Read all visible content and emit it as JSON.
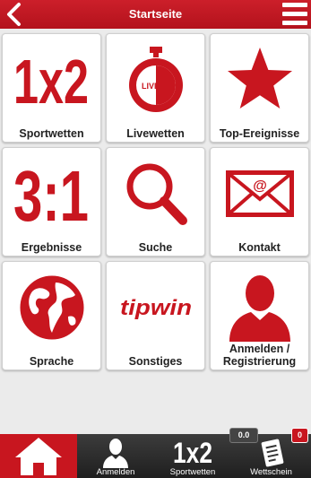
{
  "header": {
    "title": "Startseite"
  },
  "tiles": [
    {
      "label": "Sportwetten",
      "icon": "1x2-icon"
    },
    {
      "label": "Livewetten",
      "icon": "live-stopwatch-icon",
      "icon_text": "LIVE"
    },
    {
      "label": "Top-Ereignisse",
      "icon": "star-icon"
    },
    {
      "label": "Ergebnisse",
      "icon": "score-3-1-icon"
    },
    {
      "label": "Suche",
      "icon": "magnifier-icon"
    },
    {
      "label": "Kontakt",
      "icon": "envelope-at-icon"
    },
    {
      "label": "Sprache",
      "icon": "globe-icon"
    },
    {
      "label": "Sonstiges",
      "icon": "tipwin-logo-icon"
    },
    {
      "label": "Anmelden / Registrierung",
      "icon": "person-icon"
    }
  ],
  "icons": {
    "odds": "1x2",
    "score": "3:1",
    "brand": "tipwin",
    "at": "@"
  },
  "tabbar": {
    "items": [
      {
        "label": "",
        "icon": "home-icon"
      },
      {
        "label": "Anmelden",
        "icon": "person-icon"
      },
      {
        "label": "Sportwetten",
        "icon": "1x2-icon"
      },
      {
        "label": "Wettschein",
        "icon": "betslip-icon"
      }
    ],
    "odds_icon": "1x2",
    "stake": "0.0",
    "slip_count": "0"
  },
  "colors": {
    "accent": "#c8161f",
    "tabbar": "#2a2a2a",
    "background": "#ebebeb"
  }
}
